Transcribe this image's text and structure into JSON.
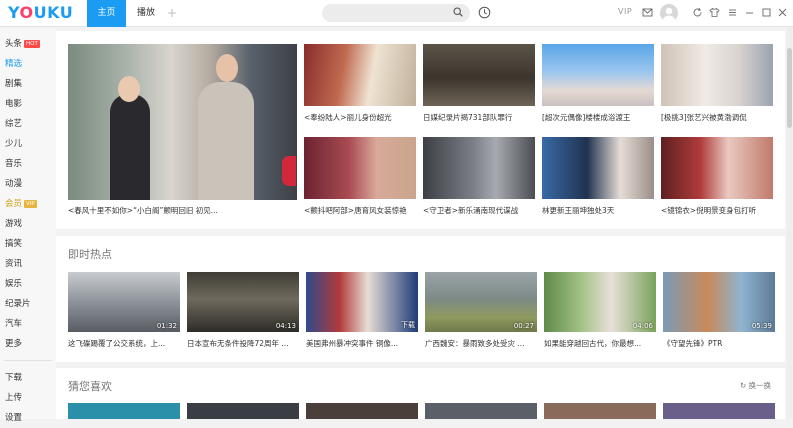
{
  "header": {
    "logo": "YOUKU",
    "tabs": [
      {
        "label": "主页",
        "active": true
      },
      {
        "label": "播放",
        "active": false
      }
    ],
    "new_tab": "+",
    "search": {
      "value": "",
      "placeholder": ""
    },
    "vip": "VIP",
    "accent": "#1b9cf2"
  },
  "sidebar": {
    "items": [
      {
        "label": "头条",
        "badge": "HOT"
      },
      {
        "label": "精选",
        "active": true
      },
      {
        "label": "剧集"
      },
      {
        "label": "电影"
      },
      {
        "label": "综艺"
      },
      {
        "label": "少儿"
      },
      {
        "label": "音乐"
      },
      {
        "label": "动漫"
      },
      {
        "label": "会员",
        "badge": "VIP"
      },
      {
        "label": "游戏"
      },
      {
        "label": "搞笑"
      },
      {
        "label": "资讯"
      },
      {
        "label": "娱乐"
      },
      {
        "label": "纪录片"
      },
      {
        "label": "汽车"
      },
      {
        "label": "更多"
      }
    ],
    "bottom_items": [
      {
        "label": "下载"
      },
      {
        "label": "上传"
      },
      {
        "label": "设置"
      }
    ]
  },
  "featured": {
    "hero": {
      "caption": "<春风十里不如你>“小白阁”颤明回旧 初见..."
    },
    "tiles": [
      {
        "caption": "<奉纷陆人>丽儿身份超光"
      },
      {
        "caption": "日媒纪录片揭731部队罪行"
      },
      {
        "caption": "[超次元偶像]楼楼成浴渡王"
      },
      {
        "caption": "[极挑3]张艺兴被黄渤调侃"
      },
      {
        "caption": "<颤抖吧阿部>唐育风女装惊艳"
      },
      {
        "caption": "<守卫者>新乐涌南现代谍战"
      },
      {
        "caption": "林更新王丽坤独处3天"
      },
      {
        "caption": "<镜锦衣>倪明景变身包打听"
      }
    ]
  },
  "hot": {
    "title": "即时热点",
    "items": [
      {
        "caption": "这飞碟踢覆了公交系统，上...",
        "duration": "01:32"
      },
      {
        "caption": "日本宣布无条件投降72周年 ...",
        "duration": "04:13"
      },
      {
        "caption": "美国弗州暴冲突事件 铜像...",
        "duration": "下载"
      },
      {
        "caption": "广西魏安：暴雨致多处受灾 ...",
        "duration": "00:27"
      },
      {
        "caption": "如果能穿越回古代，你最想...",
        "duration": "04:06"
      },
      {
        "caption": "《守望先锋》PTR",
        "duration": "05:39"
      }
    ]
  },
  "guess": {
    "title": "猜您喜欢",
    "refresh": "换一换"
  }
}
